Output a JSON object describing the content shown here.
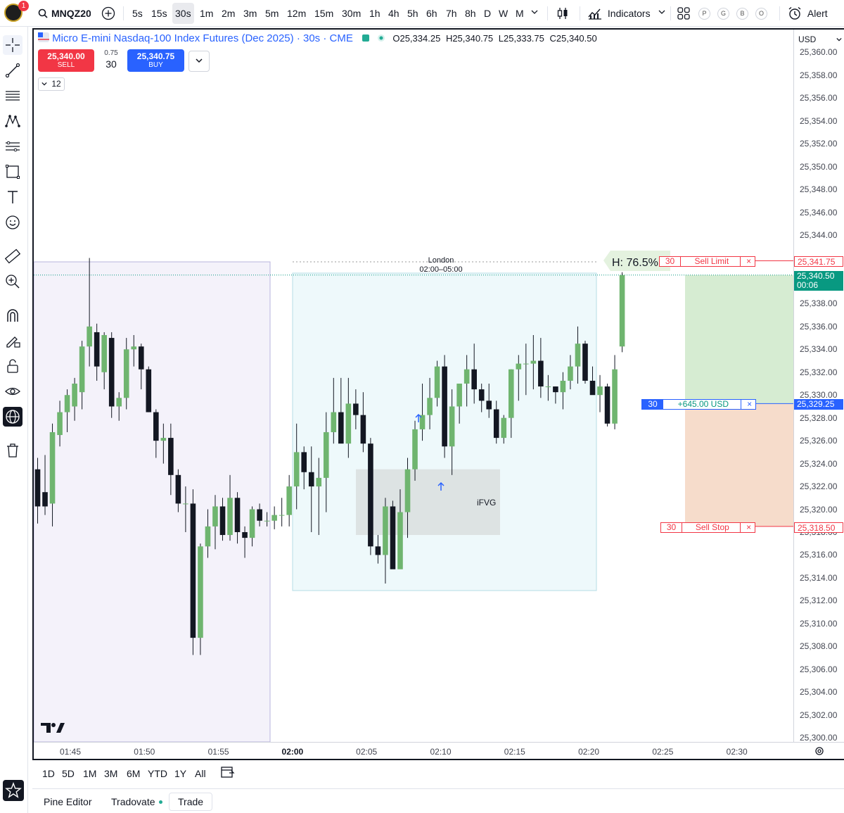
{
  "topbar": {
    "notification_count": "1",
    "symbol": "MNQZ20",
    "intervals": [
      "5s",
      "15s",
      "30s",
      "1m",
      "2m",
      "3m",
      "5m",
      "12m",
      "15m",
      "30m",
      "1h",
      "4h",
      "5h",
      "6h",
      "7h",
      "8h",
      "D",
      "W",
      "M"
    ],
    "selected_interval": "30s",
    "indicators_label": "Indicators",
    "template_pills": [
      "P",
      "G",
      "B",
      "O"
    ],
    "alert_label": "Alert"
  },
  "legend": {
    "title": "Micro E-mini Nasdaq-100 Index Futures (Dec 2025) · 30s · CME",
    "open_label": "O",
    "open": "25,334.25",
    "high_label": "H",
    "high": "25,340.75",
    "low_label": "L",
    "low": "25,333.75",
    "close_label": "C",
    "close": "25,340.50"
  },
  "trade_panel": {
    "sell_price": "25,340.00",
    "sell_label": "SELL",
    "spread": "0.75",
    "quantity": "30",
    "buy_price": "25,340.75",
    "buy_label": "BUY",
    "collapse_count": "12"
  },
  "session": {
    "name": "London",
    "hours": "02:00–05:00"
  },
  "annotations": {
    "ifvg_label": "iFVG",
    "hit_label": "H: 76.5%"
  },
  "orders": {
    "sell_limit": {
      "qty": "30",
      "label": "Sell Limit",
      "price": "25,341.75",
      "close": "×"
    },
    "position": {
      "qty": "30",
      "pnl": "+645.00 USD",
      "price": "25,329.25",
      "close": "×"
    },
    "sell_stop": {
      "qty": "30",
      "label": "Sell Stop",
      "price": "25,318.50",
      "close": "×"
    },
    "last_price": "25,340.50",
    "countdown": "00:06"
  },
  "price_scale": {
    "currency": "USD",
    "labels": [
      "25,360.00",
      "25,358.00",
      "25,356.00",
      "25,354.00",
      "25,352.00",
      "25,350.00",
      "25,348.00",
      "25,346.00",
      "25,344.00",
      "25,338.00",
      "25,336.00",
      "25,334.00",
      "25,332.00",
      "25,330.00",
      "25,328.00",
      "25,326.00",
      "25,324.00",
      "25,322.00",
      "25,320.00",
      "25,318.00",
      "25,316.00",
      "25,314.00",
      "25,312.00",
      "25,310.00",
      "25,308.00",
      "25,306.00",
      "25,304.00",
      "25,302.00",
      "25,300.00"
    ]
  },
  "time_scale": {
    "labels": [
      "01:45",
      "01:50",
      "01:55",
      "02:00",
      "02:05",
      "02:10",
      "02:15",
      "02:20",
      "02:25",
      "02:30"
    ],
    "bold_label": "02:00"
  },
  "range_bar": {
    "ranges": [
      "1D",
      "5D",
      "1M",
      "3M",
      "6M",
      "YTD",
      "1Y",
      "All"
    ]
  },
  "bottom_bar": {
    "tabs": [
      "Pine Editor",
      "Tradovate",
      "Trade"
    ]
  },
  "colors": {
    "up": "#6fb56f",
    "down": "#131722",
    "session_fill": "#eef9fb",
    "pre_session_fill": "#f4f2fa",
    "sell": "#f23645",
    "buy": "#2962ff",
    "target_fill": "#d6ecd2",
    "stop_fill": "#f6dccb"
  },
  "chart_data": {
    "type": "candlestick",
    "interval": "30s",
    "ylim": [
      25300,
      25360
    ],
    "x_start": "01:42:30",
    "candles": [
      [
        25323.5,
        25324.5,
        25318.75,
        25320.25
      ],
      [
        25321.5,
        25324.75,
        25319.5,
        25320.25
      ],
      [
        25320.5,
        25327.5,
        25318.5,
        25326.75
      ],
      [
        25326.5,
        25329.5,
        25325.5,
        25328.5
      ],
      [
        25328.5,
        25330.5,
        25326.75,
        25330.0
      ],
      [
        25329.0,
        25331.5,
        25327.75,
        25331.0
      ],
      [
        25330.25,
        25334.75,
        25328.75,
        25334.25
      ],
      [
        25334.25,
        25342.0,
        25332.5,
        25336.0
      ],
      [
        25335.5,
        25336.25,
        25331.25,
        25332.5
      ],
      [
        25332.0,
        25335.5,
        25330.5,
        25335.25
      ],
      [
        25335.0,
        25335.5,
        25328.0,
        25329.0
      ],
      [
        25329.0,
        25330.25,
        25327.75,
        25329.75
      ],
      [
        25329.75,
        25335.0,
        25328.75,
        25334.0
      ],
      [
        25334.0,
        25335.25,
        25332.5,
        25334.25
      ],
      [
        25334.25,
        25334.5,
        25330.5,
        25332.25
      ],
      [
        25332.25,
        25332.5,
        25328.5,
        25328.5
      ],
      [
        25328.5,
        25328.75,
        25324.5,
        25326.0
      ],
      [
        25326.0,
        25327.5,
        25324.0,
        25326.25
      ],
      [
        25326.25,
        25327.5,
        25321.25,
        25323.0
      ],
      [
        25323.0,
        25323.5,
        25319.75,
        25320.5
      ],
      [
        25320.5,
        25322.0,
        25318.0,
        25320.5
      ],
      [
        25320.5,
        25321.75,
        25307.25,
        25308.75
      ],
      [
        25308.75,
        25317.0,
        25307.25,
        25316.75
      ],
      [
        25316.75,
        25320.0,
        25315.75,
        25318.5
      ],
      [
        25318.5,
        25321.25,
        25316.5,
        25320.25
      ],
      [
        25320.25,
        25321.0,
        25317.25,
        25317.75
      ],
      [
        25317.75,
        25323.0,
        25317.25,
        25321.0
      ],
      [
        25321.0,
        25321.5,
        25317.0,
        25318.0
      ],
      [
        25318.0,
        25318.5,
        25315.75,
        25317.5
      ],
      [
        25317.5,
        25320.25,
        25316.75,
        25320.0
      ],
      [
        25320.0,
        25320.5,
        25318.5,
        25319.0
      ],
      [
        25319.0,
        25319.75,
        25318.5,
        25319.0
      ],
      [
        25319.0,
        25320.25,
        25318.25,
        25319.5
      ],
      [
        25319.5,
        25321.0,
        25318.5,
        25319.5
      ],
      [
        25319.5,
        25323.0,
        25318.5,
        25322.0
      ],
      [
        25322.0,
        25327.5,
        25320.0,
        25325.0
      ],
      [
        25325.0,
        25325.5,
        25321.75,
        25323.25
      ],
      [
        25323.25,
        25325.5,
        25318.0,
        25322.0
      ],
      [
        25322.0,
        25324.5,
        25317.75,
        25322.75
      ],
      [
        25322.75,
        25328.5,
        25319.75,
        25326.75
      ],
      [
        25326.75,
        25331.5,
        25325.75,
        25328.5
      ],
      [
        25328.5,
        25331.5,
        25326.0,
        25325.75
      ],
      [
        25325.75,
        25331.5,
        25324.5,
        25329.25
      ],
      [
        25329.25,
        25330.5,
        25327.0,
        25328.25
      ],
      [
        25328.25,
        25330.25,
        25325.0,
        25325.75
      ],
      [
        25325.75,
        25326.25,
        25316.0,
        25316.75
      ],
      [
        25316.75,
        25317.75,
        25315.25,
        25316.0
      ],
      [
        25316.0,
        25321.0,
        25313.5,
        25320.25
      ],
      [
        25320.25,
        25320.75,
        25315.25,
        25314.75
      ],
      [
        25314.75,
        25321.75,
        25315.0,
        25319.75
      ],
      [
        25319.75,
        25324.5,
        25317.5,
        25323.5
      ],
      [
        25323.5,
        25327.75,
        25322.5,
        25327.0
      ],
      [
        25327.0,
        25331.0,
        25326.0,
        25328.25
      ],
      [
        25328.25,
        25331.5,
        25327.0,
        25329.75
      ],
      [
        25329.75,
        25333.0,
        25329.0,
        25332.5
      ],
      [
        25332.5,
        25333.5,
        25324.5,
        25325.5
      ],
      [
        25325.5,
        25330.5,
        25323.0,
        25329.0
      ],
      [
        25329.0,
        25331.0,
        25327.5,
        25331.0
      ],
      [
        25331.0,
        25333.5,
        25329.0,
        25332.25
      ],
      [
        25332.25,
        25334.5,
        25329.25,
        25330.5
      ],
      [
        25330.5,
        25331.0,
        25328.5,
        25329.5
      ],
      [
        25329.5,
        25331.0,
        25328.0,
        25328.75
      ],
      [
        25328.75,
        25329.5,
        25325.75,
        25326.25
      ],
      [
        25326.25,
        25328.25,
        25325.75,
        25328.0
      ],
      [
        25328.0,
        25332.25,
        25326.25,
        25332.25
      ],
      [
        25332.25,
        25333.5,
        25329.5,
        25332.75
      ],
      [
        25332.75,
        25334.5,
        25330.0,
        25332.75
      ],
      [
        25332.75,
        25335.25,
        25330.5,
        25333.0
      ],
      [
        25333.0,
        25335.0,
        25329.75,
        25330.75
      ],
      [
        25330.75,
        25331.75,
        25329.5,
        25330.75
      ],
      [
        25330.75,
        25330.75,
        25329.25,
        25330.25
      ],
      [
        25330.25,
        25332.0,
        25328.75,
        25331.25
      ],
      [
        25331.25,
        25333.5,
        25330.5,
        25332.5
      ],
      [
        25332.5,
        25336.0,
        25331.0,
        25334.5
      ],
      [
        25334.5,
        25334.75,
        25331.0,
        25331.25
      ],
      [
        25331.25,
        25332.5,
        25331.0,
        25330.0
      ],
      [
        25330.0,
        25331.75,
        25328.5,
        25330.75
      ],
      [
        25330.75,
        25331.0,
        25327.25,
        25327.5
      ],
      [
        25327.5,
        25333.5,
        25327.0,
        25332.25
      ],
      [
        25334.25,
        25340.75,
        25333.75,
        25340.5
      ]
    ]
  }
}
